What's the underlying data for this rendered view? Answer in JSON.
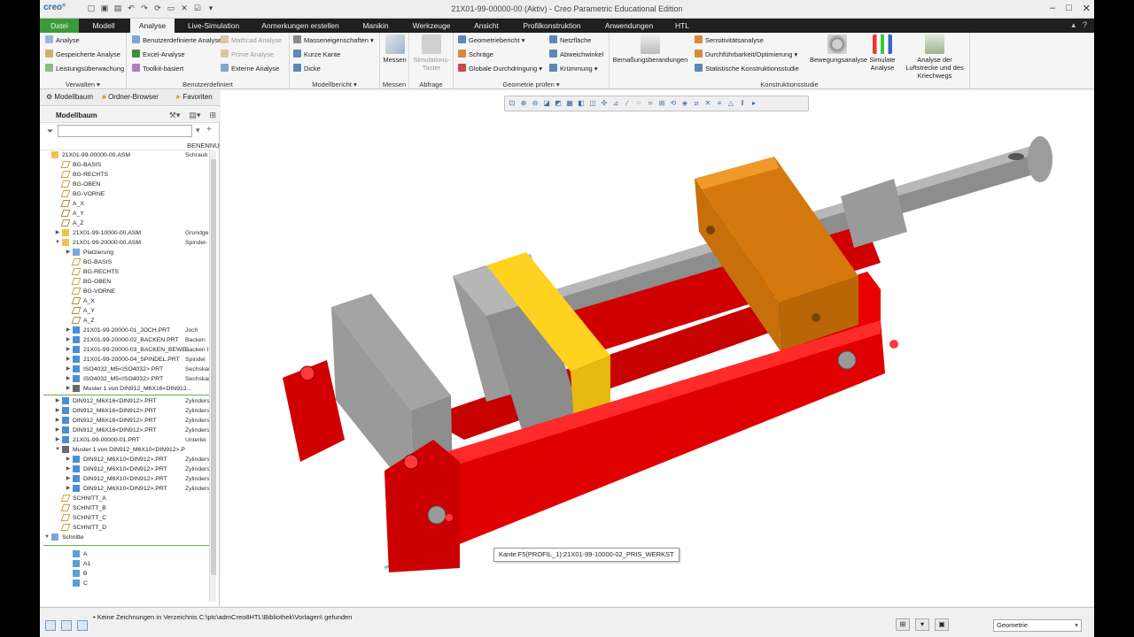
{
  "titlebar": {
    "logo": "creo°",
    "title": "21X01-99-00000-00 (Aktiv) - Creo Parametric Educational Edition",
    "min": "–",
    "max": "□",
    "close": "✕"
  },
  "tabs": [
    {
      "label": "Datei"
    },
    {
      "label": "Modell"
    },
    {
      "label": "Analyse"
    },
    {
      "label": "Live-Simulation"
    },
    {
      "label": "Anmerkungen erstellen"
    },
    {
      "label": "Manikin"
    },
    {
      "label": "Werkzeuge"
    },
    {
      "label": "Ansicht"
    },
    {
      "label": "Profilkonstruktion"
    },
    {
      "label": "Anwendungen"
    },
    {
      "label": "HTL"
    }
  ],
  "ribbon": {
    "verwalten": {
      "title": "Verwalten ▾",
      "items": [
        "Analyse",
        "Gespeicherte Analyse",
        "Leistungsüberwachung"
      ]
    },
    "benutzerdefiniert": {
      "title": "Benutzerdefiniert",
      "items": [
        "Benutzerdefinierte Analyse",
        "Excel-Analyse",
        "Toolkit-basiert",
        "Mathcad Analyse",
        "Prime Analyse",
        "Externe Analyse"
      ]
    },
    "modellbericht": {
      "title": "Modellbericht ▾",
      "items": [
        "Masseneigenschaften ▾",
        "Kurze Kante",
        "Dicke"
      ]
    },
    "messen": {
      "title": "Messen",
      "button": "Messen"
    },
    "abfrage": {
      "title": "Abfrage",
      "button": "Simulations-Taster"
    },
    "geometrie": {
      "title": "Geometrie prüfen ▾",
      "items": [
        "Geometriebericht ▾",
        "Schräge",
        "Globale Durchdringung ▾",
        "Netzfläche",
        "Abweichwinkel",
        "Krümmung ▾"
      ]
    },
    "konstruktion": {
      "title": "Konstruktionsstudie",
      "bem": "Bemaßungsberandungen",
      "items": [
        "Sensitivitätsanalyse",
        "Durchführbarkeit/Optimierung ▾",
        "Statistische Konstruktionsstudie"
      ],
      "buttons": [
        "Bewegungsanalyse",
        "Simulate Analyse",
        "Analyse der Luftstrecke und des Kriechwegs"
      ]
    }
  },
  "panel": {
    "tabs": [
      "Modellbaum",
      "Ordner-Browser",
      "Favoriten"
    ],
    "header": "Modellbaum",
    "column": "BENENNU",
    "search_placeholder": ""
  },
  "tree": [
    {
      "name": "21X01-99-00000-00.ASM",
      "desc": "Schraub",
      "icon": "asm",
      "indent": 0,
      "exp": ""
    },
    {
      "name": "BG-BASIS",
      "desc": "",
      "icon": "plane",
      "indent": 1,
      "exp": ""
    },
    {
      "name": "BG-RECHTS",
      "desc": "",
      "icon": "plane",
      "indent": 1,
      "exp": ""
    },
    {
      "name": "BG-OBEN",
      "desc": "",
      "icon": "plane",
      "indent": 1,
      "exp": ""
    },
    {
      "name": "BG-VORNE",
      "desc": "",
      "icon": "plane",
      "indent": 1,
      "exp": ""
    },
    {
      "name": "A_X",
      "desc": "",
      "icon": "axis",
      "indent": 1,
      "exp": ""
    },
    {
      "name": "A_Y",
      "desc": "",
      "icon": "axis",
      "indent": 1,
      "exp": ""
    },
    {
      "name": "A_Z",
      "desc": "",
      "icon": "axis",
      "indent": 1,
      "exp": ""
    },
    {
      "name": "21X01-99-10000-00.ASM",
      "desc": "Grundge",
      "icon": "asm",
      "indent": 1,
      "exp": "▶"
    },
    {
      "name": "21X01-99-20000-00.ASM",
      "desc": "Spindel-",
      "icon": "asm",
      "indent": 1,
      "exp": "▼"
    },
    {
      "name": "Platzierung",
      "desc": "",
      "icon": "folder",
      "indent": 2,
      "exp": "▶"
    },
    {
      "name": "BG-BASIS",
      "desc": "",
      "icon": "plane",
      "indent": 2,
      "exp": ""
    },
    {
      "name": "BG-RECHTS",
      "desc": "",
      "icon": "plane",
      "indent": 2,
      "exp": ""
    },
    {
      "name": "BG-OBEN",
      "desc": "",
      "icon": "plane",
      "indent": 2,
      "exp": ""
    },
    {
      "name": "BG-VORNE",
      "desc": "",
      "icon": "plane",
      "indent": 2,
      "exp": ""
    },
    {
      "name": "A_X",
      "desc": "",
      "icon": "axis",
      "indent": 2,
      "exp": ""
    },
    {
      "name": "A_Y",
      "desc": "",
      "icon": "axis",
      "indent": 2,
      "exp": ""
    },
    {
      "name": "A_Z",
      "desc": "",
      "icon": "axis",
      "indent": 2,
      "exp": ""
    },
    {
      "name": "21X01-99-20000-01_JOCH.PRT",
      "desc": "Joch",
      "icon": "prt",
      "indent": 2,
      "exp": "▶"
    },
    {
      "name": "21X01-99-20000-02_BACKEN.PRT",
      "desc": "Backen",
      "icon": "prt",
      "indent": 2,
      "exp": "▶"
    },
    {
      "name": "21X01-99-20000-03_BACKEN_BEWE...",
      "desc": "Backen I",
      "icon": "prt",
      "indent": 2,
      "exp": "▶"
    },
    {
      "name": "21X01-99-20000-04_SPINDEL.PRT",
      "desc": "Spindel",
      "icon": "prt",
      "indent": 2,
      "exp": "▶"
    },
    {
      "name": "ISO4032_M5<ISO4032>.PRT",
      "desc": "Sechskar",
      "icon": "prt",
      "indent": 2,
      "exp": "▶"
    },
    {
      "name": "ISO4032_M5<ISO4032>.PRT",
      "desc": "Sechskar",
      "icon": "prt",
      "indent": 2,
      "exp": "▶"
    },
    {
      "name": "Muster 1 von DIN912_M6X16<DIN912...",
      "desc": "",
      "icon": "pattern",
      "indent": 2,
      "exp": "▶"
    },
    {
      "name": "DIN912_M6X16<DIN912>.PRT",
      "desc": "Zylinders",
      "icon": "prt",
      "indent": 1,
      "exp": "▶"
    },
    {
      "name": "DIN912_M6X16<DIN912>.PRT",
      "desc": "Zylinders",
      "icon": "prt",
      "indent": 1,
      "exp": "▶"
    },
    {
      "name": "DIN912_M6X16<DIN912>.PRT",
      "desc": "Zylinders",
      "icon": "prt",
      "indent": 1,
      "exp": "▶"
    },
    {
      "name": "DIN912_M6X16<DIN912>.PRT",
      "desc": "Zylinders",
      "icon": "prt",
      "indent": 1,
      "exp": "▶"
    },
    {
      "name": "21X01-99-00000-01.PRT",
      "desc": "Unterlei",
      "icon": "prt",
      "indent": 1,
      "exp": "▶"
    },
    {
      "name": "Muster 1 von DIN912_M6X10<DIN912>.P",
      "desc": "",
      "icon": "pattern",
      "indent": 1,
      "exp": "▼"
    },
    {
      "name": "DIN912_M6X10<DIN912>.PRT",
      "desc": "Zylinders",
      "icon": "prt",
      "indent": 2,
      "exp": "▶"
    },
    {
      "name": "DIN912_M6X10<DIN912>.PRT",
      "desc": "Zylinders",
      "icon": "prt",
      "indent": 2,
      "exp": "▶"
    },
    {
      "name": "DIN912_M6X10<DIN912>.PRT",
      "desc": "Zylinders",
      "icon": "prt",
      "indent": 2,
      "exp": "▶"
    },
    {
      "name": "DIN912_M6X10<DIN912>.PRT",
      "desc": "Zylinders",
      "icon": "prt",
      "indent": 2,
      "exp": "▶"
    },
    {
      "name": "SCHNITT_A",
      "desc": "",
      "icon": "plane",
      "indent": 1,
      "exp": ""
    },
    {
      "name": "SCHNITT_B",
      "desc": "",
      "icon": "plane",
      "indent": 1,
      "exp": ""
    },
    {
      "name": "SCHNITT_C",
      "desc": "",
      "icon": "plane",
      "indent": 1,
      "exp": ""
    },
    {
      "name": "SCHNITT_D",
      "desc": "",
      "icon": "plane",
      "indent": 1,
      "exp": ""
    },
    {
      "name": "Schnitte",
      "desc": "",
      "icon": "folder",
      "indent": 0,
      "exp": "▼"
    },
    {
      "name": "A",
      "desc": "",
      "icon": "section",
      "indent": 2,
      "exp": ""
    },
    {
      "name": "A1",
      "desc": "",
      "icon": "section",
      "indent": 2,
      "exp": ""
    },
    {
      "name": "B",
      "desc": "",
      "icon": "section",
      "indent": 2,
      "exp": ""
    },
    {
      "name": "C",
      "desc": "",
      "icon": "section",
      "indent": 2,
      "exp": ""
    }
  ],
  "viewport": {
    "tooltip": "Kante:F5(PROFIL_1):21X01-99-10000-02_PRIS_WERKST"
  },
  "statusbar": {
    "message": "• Keine Zeichnungen in Verzeichnis C:\\ptc\\admCreo8HTL\\Bibliothek\\Vorlagen\\ gefunden",
    "filter": "Geometrie"
  },
  "colors": {
    "datei_tab": "#3c9b39",
    "tabbar": "#1f1f1f",
    "red_part": "#e00000",
    "grey_part": "#a8a8a8",
    "yellow_part": "#ffd21f",
    "orange_part": "#d87d10",
    "spindle": "#8a8a8a"
  }
}
